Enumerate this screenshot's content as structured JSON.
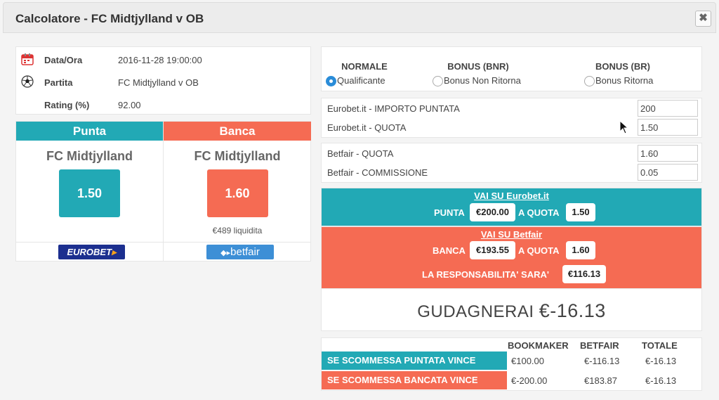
{
  "window": {
    "title": "Calcolatore - FC Midtjylland v OB",
    "close_glyph": "✖"
  },
  "info": {
    "rows": [
      {
        "icon": "calendar-icon",
        "label": "Data/Ora",
        "value": "2016-11-28 19:00:00"
      },
      {
        "icon": "soccer-ball-icon",
        "label": "Partita",
        "value": "FC Midtjylland v OB"
      },
      {
        "icon": "",
        "label": "Rating (%)",
        "value": "92.00"
      }
    ]
  },
  "punta": {
    "header": "Punta",
    "team": "FC Midtjylland",
    "odd": "1.50",
    "logo": "EUROBET",
    "color": "#22a9b5"
  },
  "banca": {
    "header": "Banca",
    "team": "FC Midtjylland",
    "odd": "1.60",
    "liquidity": "€489 liquidita",
    "logo": "betfair",
    "color": "#f56b53"
  },
  "modes": [
    {
      "title": "NORMALE",
      "option": "Qualificante",
      "selected": true
    },
    {
      "title": "BONUS (BNR)",
      "option": "Bonus Non Ritorna",
      "selected": false
    },
    {
      "title": "BONUS (BR)",
      "option": "Bonus Ritorna",
      "selected": false
    }
  ],
  "bookmaker_form": {
    "stake_label": "Eurobet.it - IMPORTO PUNTATA",
    "stake_value": "200",
    "odd_label": "Eurobet.it - QUOTA",
    "odd_value": "1.50"
  },
  "exchange_form": {
    "odd_label": "Betfair - QUOTA",
    "odd_value": "1.60",
    "commission_label": "Betfair - COMMISSIONE",
    "commission_value": "0.05"
  },
  "back_instruction": {
    "link": "VAI SU Eurobet.it",
    "action": "PUNTA",
    "amount": "€200.00",
    "at_odds": "A QUOTA",
    "odds": "1.50"
  },
  "lay_instruction": {
    "link": "VAI SU Betfair",
    "action": "BANCA",
    "amount": "€193.55",
    "at_odds": "A QUOTA",
    "odds": "1.60",
    "liability_label": "LA RESPONSABILITA' SARA'",
    "liability": "€116.13"
  },
  "profit": {
    "text": "GUDAGNERAI",
    "amount": "€-16.13"
  },
  "outcomes": {
    "headers": [
      "BOOKMAKER",
      "BETFAIR",
      "TOTALE"
    ],
    "rows": [
      {
        "label": "SE SCOMMESSA PUNTATA VINCE",
        "bookmaker": "€100.00",
        "betfair": "€-116.13",
        "total": "€-16.13"
      },
      {
        "label": "SE SCOMMESSA BANCATA VINCE",
        "bookmaker": "€-200.00",
        "betfair": "€183.87",
        "total": "€-16.13"
      }
    ]
  }
}
